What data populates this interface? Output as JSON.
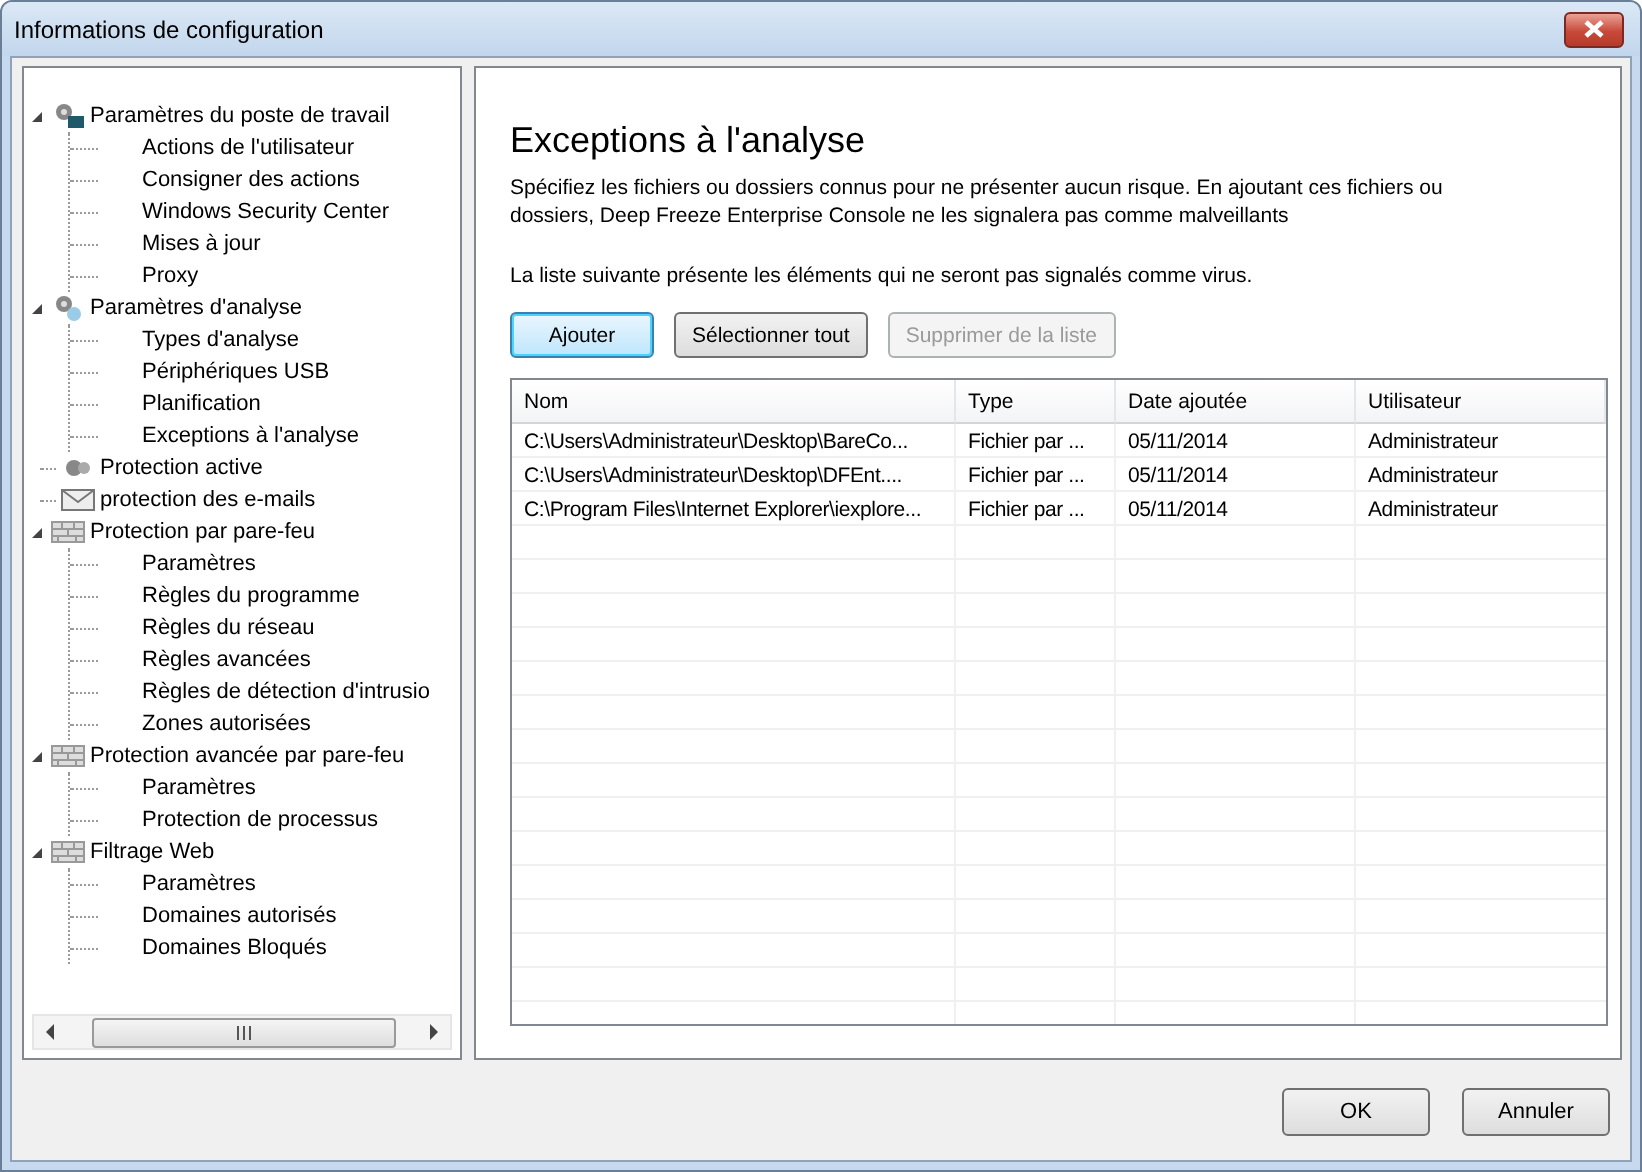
{
  "window": {
    "title": "Informations de configuration"
  },
  "tree": [
    {
      "label": "Paramètres du poste de travail",
      "kind": "settings",
      "expanded": true,
      "children": [
        {
          "label": "Actions de l'utilisateur",
          "selected": false
        },
        {
          "label": "Consigner des actions",
          "selected": false
        },
        {
          "label": "Windows Security Center",
          "selected": false
        },
        {
          "label": "Mises à jour",
          "selected": false
        },
        {
          "label": "Proxy",
          "selected": false
        }
      ]
    },
    {
      "label": "Paramètres d'analyse",
      "kind": "scan",
      "expanded": true,
      "children": [
        {
          "label": "Types d'analyse",
          "selected": false
        },
        {
          "label": "Périphériques USB",
          "selected": false
        },
        {
          "label": "Planification",
          "selected": false
        },
        {
          "label": "Exceptions à l'analyse",
          "selected": false
        }
      ]
    },
    {
      "label": "Protection active",
      "kind": "shield"
    },
    {
      "label": "protection des e-mails",
      "kind": "email"
    },
    {
      "label": "Protection par pare-feu",
      "kind": "firewall",
      "expanded": true,
      "children": [
        {
          "label": "Paramètres",
          "selected": false
        },
        {
          "label": "Règles du programme",
          "selected": false
        },
        {
          "label": "Règles du réseau",
          "selected": false
        },
        {
          "label": "Règles avancées",
          "selected": false
        },
        {
          "label": "Règles de détection d'intrusio",
          "selected": false
        },
        {
          "label": "Zones autorisées",
          "selected": false
        }
      ]
    },
    {
      "label": "Protection avancée par pare-feu",
      "kind": "firewall",
      "expanded": true,
      "children": [
        {
          "label": "Paramètres",
          "selected": false
        },
        {
          "label": "Protection de processus",
          "selected": false
        }
      ]
    },
    {
      "label": "Filtrage Web",
      "kind": "firewall",
      "expanded": true,
      "children": [
        {
          "label": "Paramètres",
          "selected": false
        },
        {
          "label": "Domaines autorisés",
          "selected": false
        },
        {
          "label": "Domaines Bloqués",
          "selected": false
        }
      ]
    }
  ],
  "content": {
    "heading": "Exceptions à l'analyse",
    "description": "Spécifiez les fichiers ou dossiers connus pour ne présenter aucun risque. En ajoutant ces fichiers ou dossiers, Deep Freeze Enterprise Console ne les signalera pas comme malveillants",
    "list_note": "La liste suivante présente les éléments qui ne seront pas signalés comme virus.",
    "buttons": [
      {
        "label": "Ajouter",
        "disabled": false,
        "default": true
      },
      {
        "label": "Sélectionner tout",
        "disabled": false,
        "default": false
      },
      {
        "label": "Supprimer de la liste",
        "disabled": true,
        "default": false
      }
    ],
    "table": {
      "columns": [
        "Nom",
        "Type",
        "Date ajoutée",
        "Utilisateur"
      ],
      "rows": [
        [
          "C:\\Users\\Administrateur\\Desktop\\BareCo...",
          "Fichier par ...",
          "05/11/2014",
          "Administrateur"
        ],
        [
          "C:\\Users\\Administrateur\\Desktop\\DFEnt....",
          "Fichier par ...",
          "05/11/2014",
          "Administrateur"
        ],
        [
          "C:\\Program Files\\Internet Explorer\\iexplore...",
          "Fichier par ...",
          "05/11/2014",
          "Administrateur"
        ]
      ]
    }
  },
  "footer_buttons": [
    "OK",
    "Annuler"
  ]
}
